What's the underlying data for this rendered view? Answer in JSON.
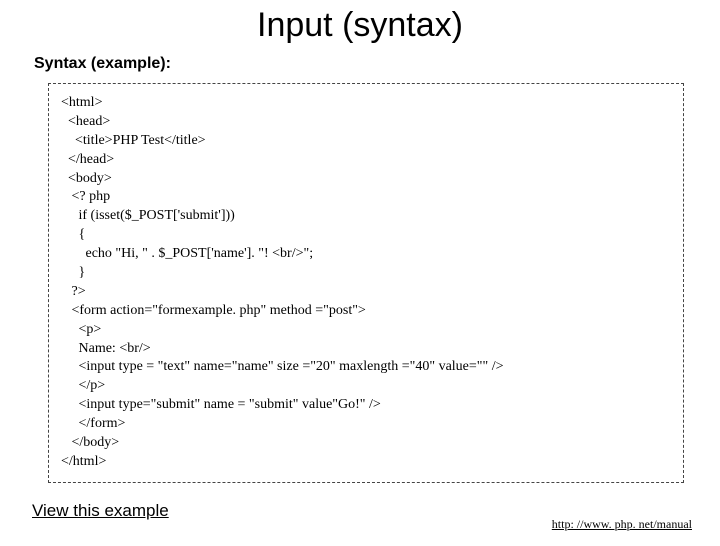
{
  "title": "Input (syntax)",
  "subhead": "Syntax (example):",
  "code": "<html>\n  <head>\n    <title>PHP Test</title>\n  </head>\n  <body>\n   <? php\n     if (isset($_POST['submit']))\n     {\n       echo \"Hi, \" . $_POST['name']. \"! <br/>\";\n     }\n   ?>\n   <form action=\"formexample. php\" method =\"post\">\n     <p>\n     Name: <br/>\n     <input type = \"text\" name=\"name\" size =\"20\" maxlength =\"40\" value=\"\" />\n     </p>\n     <input type=\"submit\" name = \"submit\" value\"Go!\" />\n     </form>\n   </body>\n</html>",
  "view_link_label": "View this example",
  "footer_url": "http: //www. php. net/manual"
}
